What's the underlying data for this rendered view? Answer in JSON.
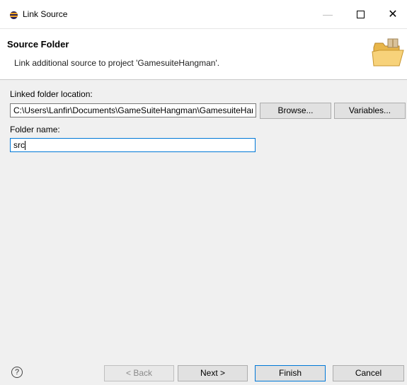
{
  "window": {
    "title": "Link Source",
    "icon": "eclipse-icon",
    "controls": {
      "minimize": "—",
      "maximize": "☐",
      "close": "✕"
    }
  },
  "header": {
    "title": "Source Folder",
    "description": "Link additional source to project 'GamesuiteHangman'.",
    "icon": "folder-icon"
  },
  "form": {
    "linked_location_label": "Linked folder location:",
    "linked_location_value": "C:\\Users\\Lanfir\\Documents\\GameSuiteHangman\\GamesuiteHangman\\src",
    "browse_label": "Browse...",
    "variables_label": "Variables...",
    "folder_name_label": "Folder name:",
    "folder_name_value": "src"
  },
  "footer": {
    "help_icon": "?",
    "back_label": "< Back",
    "next_label": "Next >",
    "finish_label": "Finish",
    "cancel_label": "Cancel"
  },
  "colors": {
    "focus_border": "#0078d7",
    "button_bg": "#e1e1e1",
    "content_bg": "#f0f0f0"
  }
}
